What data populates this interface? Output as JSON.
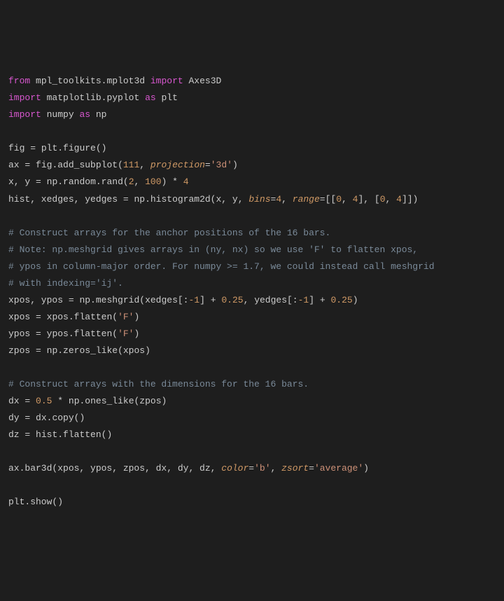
{
  "code": {
    "l1": {
      "from": "from",
      "mpl": "mpl_toolkits.mplot3d",
      "import": "import",
      "axes3d": "Axes3D"
    },
    "l2": {
      "import": "import",
      "mpl": "matplotlib.pyplot",
      "as": "as",
      "alias": "plt"
    },
    "l3": {
      "import": "import",
      "np": "numpy",
      "as": "as",
      "alias": "np"
    },
    "l5": {
      "lhs": "fig",
      "eq": "=",
      "rhs": "plt.figure()"
    },
    "l6": {
      "lhs": "ax",
      "eq": "=",
      "call": "fig.add_subplot(",
      "arg1": "111",
      "comma": ",",
      "kwarg": "projection",
      "eqk": "=",
      "str": "'3d'",
      "close": ")"
    },
    "l7": {
      "lhs": "x, y",
      "eq": "=",
      "call": "np.random.rand(",
      "a1": "2",
      "c1": ",",
      "a2": "100",
      "close": ")",
      "star": "*",
      "four": "4"
    },
    "l8": {
      "lhs": "hist, xedges, yedges",
      "eq": "=",
      "call": "np.histogram2d(x, y,",
      "kw1": "bins",
      "eqk1": "=",
      "v1": "4",
      "c2": ",",
      "kw2": "range",
      "eqk2": "=",
      "rng": "[[",
      "z1": "0",
      "c3": ",",
      "f1": "4",
      "mid": "], [",
      "z2": "0",
      "c4": ",",
      "f2": "4",
      "end": "]])"
    },
    "c1": "# Construct arrays for the anchor positions of the 16 bars.",
    "c2": "# Note: np.meshgrid gives arrays in (ny, nx) so we use 'F' to flatten xpos,",
    "c3": "# ypos in column-major order. For numpy >= 1.7, we could instead call meshgrid",
    "c4": "# with indexing='ij'.",
    "l13": {
      "lhs": "xpos, ypos",
      "eq": "=",
      "call": "np.meshgrid(xedges[:",
      "neg1": "-1",
      "mid1": "]",
      "plus1": "+",
      "off1": "0.25",
      "c": ",",
      "yarg": "yedges[:",
      "neg2": "-1",
      "mid2": "]",
      "plus2": "+",
      "off2": "0.25",
      "close": ")"
    },
    "l14": {
      "lhs": "xpos",
      "eq": "=",
      "call": "xpos.flatten(",
      "str": "'F'",
      "close": ")"
    },
    "l15": {
      "lhs": "ypos",
      "eq": "=",
      "call": "ypos.flatten(",
      "str": "'F'",
      "close": ")"
    },
    "l16": {
      "lhs": "zpos",
      "eq": "=",
      "rhs": "np.zeros_like(xpos)"
    },
    "c5": "# Construct arrays with the dimensions for the 16 bars.",
    "l19": {
      "lhs": "dx",
      "eq": "=",
      "half": "0.5",
      "star": "*",
      "rhs": "np.ones_like(zpos)"
    },
    "l20": {
      "lhs": "dy",
      "eq": "=",
      "rhs": "dx.copy()"
    },
    "l21": {
      "lhs": "dz",
      "eq": "=",
      "rhs": "hist.flatten()"
    },
    "l23": {
      "call": "ax.bar3d(xpos, ypos, zpos, dx, dy, dz,",
      "kw1": "color",
      "eqk1": "=",
      "s1": "'b'",
      "c1": ",",
      "kw2": "zsort",
      "eqk2": "=",
      "s2": "'average'",
      "close": ")"
    },
    "l25": {
      "call": "plt.show()"
    }
  }
}
